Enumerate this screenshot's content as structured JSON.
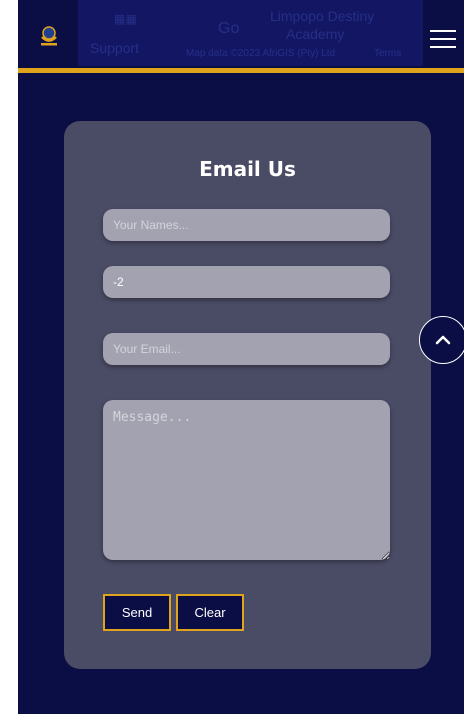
{
  "header": {
    "logo_icon": "academy-logo-icon",
    "menu_icon": "hamburger-menu-icon",
    "gold_color": "#e0a41c",
    "background_color": "#0b0d45"
  },
  "map_overlay": {
    "support_text": "Support",
    "go_text": "Go",
    "place_name_line1": "Limpopo Destiny",
    "place_name_line2": "Academy",
    "map_data": "Map data ©2023 AfriGIS (Pty) Ltd",
    "terms": "Terms"
  },
  "contact_form": {
    "title": "Email Us",
    "names_placeholder": "Your Names...",
    "number_value": "-2",
    "email_placeholder": "Your Email...",
    "message_placeholder": "Message...",
    "send_label": "Send",
    "clear_label": "Clear"
  },
  "scroll_top": {
    "icon": "chevron-up-icon"
  }
}
